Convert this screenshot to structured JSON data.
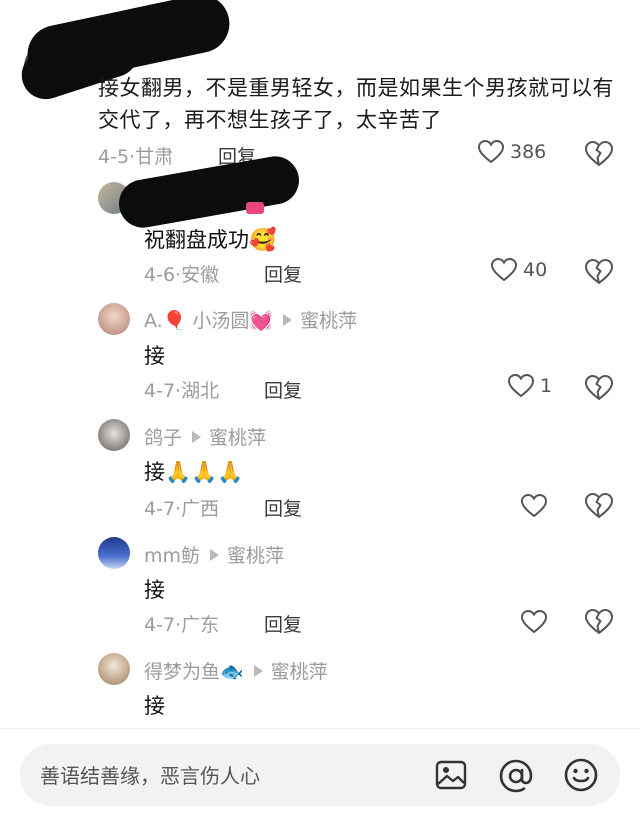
{
  "main_comment": {
    "text": "接女翻男，不是重男轻女，而是如果生个男孩就可以有交代了，再不想生孩子了，太辛苦了",
    "date": "4-5·",
    "location": "甘肃",
    "reply_label": "回复",
    "like_count": "386"
  },
  "replies": [
    {
      "text": "祝翻盘成功",
      "emoji": "🥰",
      "date": "4-6·",
      "location": "安徽",
      "reply_label": "回复",
      "like_count": "40"
    },
    {
      "author": "A.🎈 小汤圆💓",
      "reply_to": "蜜桃萍",
      "text": "接",
      "date": "4-7·",
      "location": "湖北",
      "reply_label": "回复",
      "like_count": "1"
    },
    {
      "author": "鸽子",
      "reply_to": "蜜桃萍",
      "text": "接🙏🙏🙏",
      "date": "4-7·",
      "location": "广西",
      "reply_label": "回复",
      "like_count": ""
    },
    {
      "author": "mm鲂",
      "reply_to": "蜜桃萍",
      "text": "接",
      "date": "4-7·",
      "location": "广东",
      "reply_label": "回复",
      "like_count": ""
    },
    {
      "author": "得梦为鱼🐟",
      "reply_to": "蜜桃萍",
      "text": "接"
    }
  ],
  "input_bar": {
    "placeholder": "善语结善缘，恶言伤人心"
  },
  "icons": {
    "like": "heart-outline-icon",
    "dislike": "broken-heart-icon",
    "image": "image-icon",
    "mention": "at-icon",
    "emoji": "smiley-icon"
  }
}
